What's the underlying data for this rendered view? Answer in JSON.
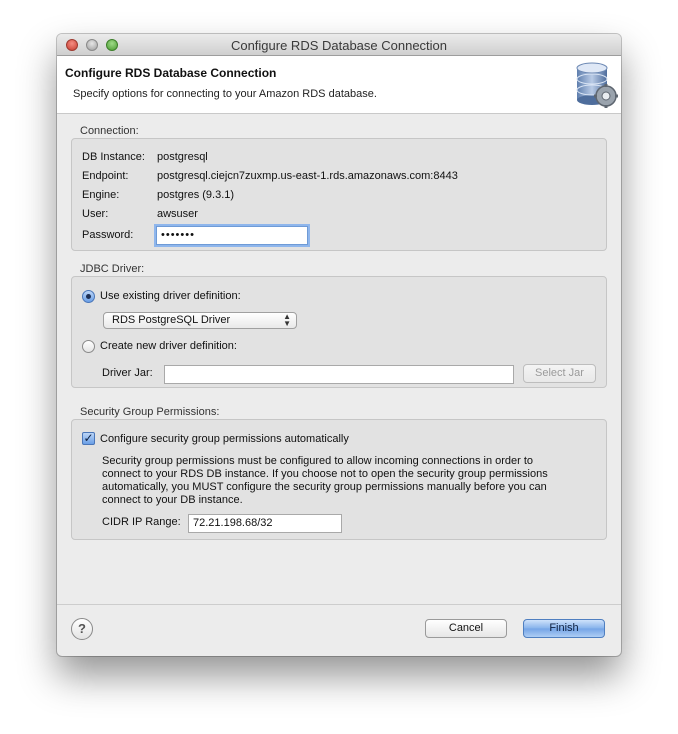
{
  "window": {
    "title": "Configure RDS Database Connection"
  },
  "header": {
    "title": "Configure RDS Database Connection",
    "description": "Specify options for connecting to your Amazon RDS database.",
    "icon": "database-gear-icon"
  },
  "connection": {
    "group_label": "Connection:",
    "db_instance_label": "DB Instance:",
    "db_instance_value": "postgresql",
    "endpoint_label": "Endpoint:",
    "endpoint_value": "postgresql.ciejcn7zuxmp.us-east-1.rds.amazonaws.com:8443",
    "engine_label": "Engine:",
    "engine_value": "postgres (9.3.1)",
    "user_label": "User:",
    "user_value": "awsuser",
    "password_label": "Password:",
    "password_value": "•••••••"
  },
  "jdbc": {
    "group_label": "JDBC Driver:",
    "use_existing_label": "Use existing driver definition:",
    "use_existing_selected": true,
    "driver_select_value": "RDS PostgreSQL Driver",
    "create_new_label": "Create new driver definition:",
    "driver_jar_label": "Driver Jar:",
    "driver_jar_value": "",
    "select_jar_label": "Select Jar"
  },
  "security": {
    "group_label": "Security Group Permissions:",
    "auto_config_label": "Configure security group permissions automatically",
    "auto_config_checked": true,
    "description_lines": [
      "Security group permissions must be configured to allow incoming connections in order to",
      "connect to your RDS DB instance.  If you choose not to open the security group permissions",
      "automatically, you MUST configure the security group permissions manually before you can",
      "connect to your DB instance."
    ],
    "cidr_label": "CIDR IP Range:",
    "cidr_value": "72.21.198.68/32"
  },
  "footer": {
    "help_symbol": "?",
    "cancel_label": "Cancel",
    "finish_label": "Finish"
  },
  "colors": {
    "accent": "#74a4e6",
    "window_bg": "#ececec",
    "group_bg": "#e2e2e2"
  }
}
